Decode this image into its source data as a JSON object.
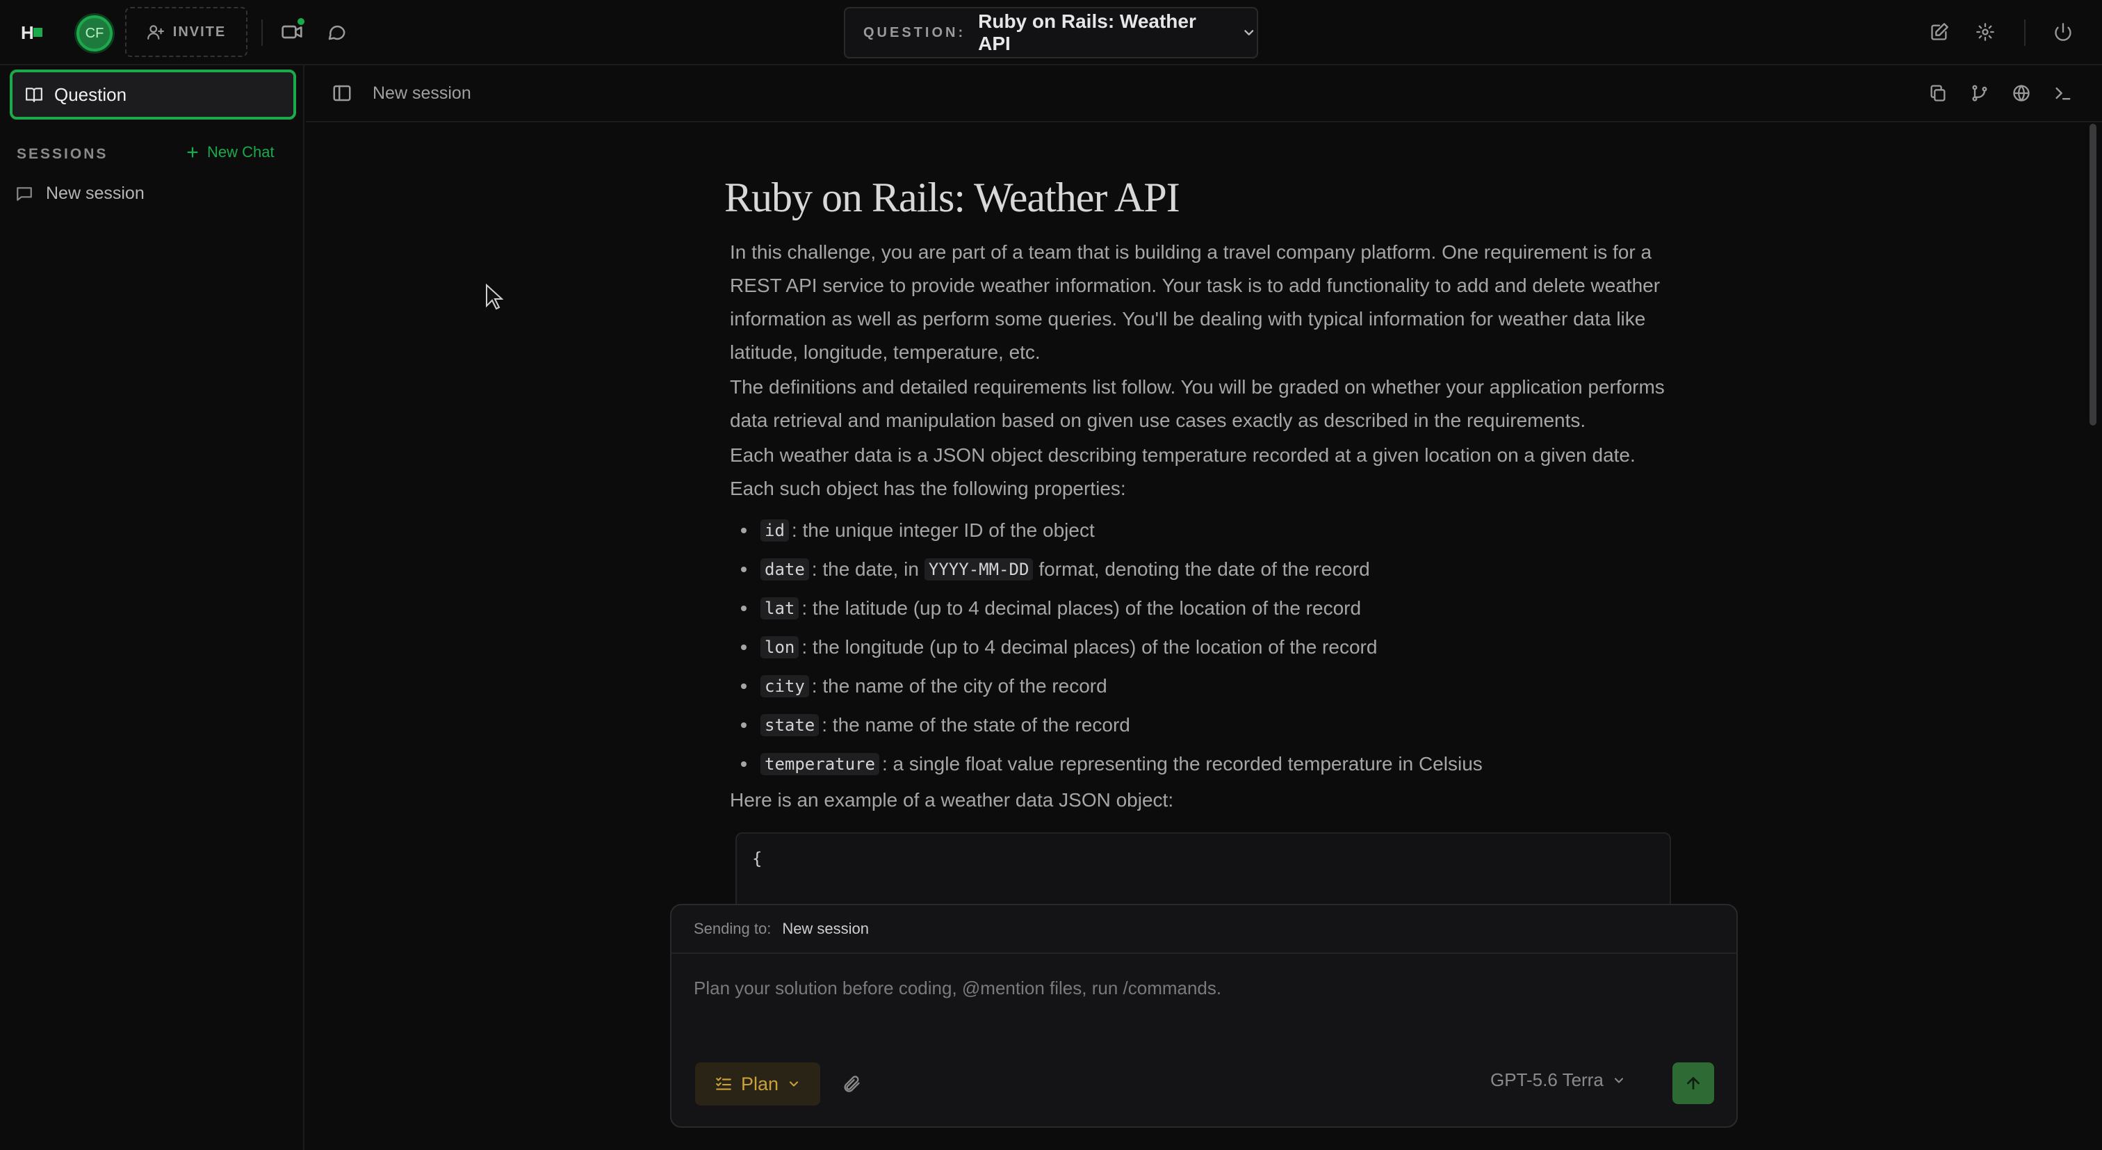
{
  "app": {
    "logo_text": "H",
    "accent": "#1ba94c"
  },
  "header": {
    "avatar_initials": "CF",
    "invite_label": "INVITE",
    "question_prefix": "QUESTION:",
    "question_title": "Ruby on Rails: Weather API"
  },
  "sidebar": {
    "question_tab_label": "Question",
    "sessions_header": "SESSIONS",
    "new_chat_label": "New Chat",
    "sessions": [
      {
        "label": "New session"
      }
    ]
  },
  "session_bar": {
    "title": "New session"
  },
  "document": {
    "title": "Ruby on Rails: Weather API",
    "paragraphs": [
      "In this challenge, you are part of a team that is building a travel company platform. One requirement is for a REST API service to provide weather information. Your task is to add functionality to add and delete weather information as well as perform some queries. You'll be dealing with typical information for weather data like latitude, longitude, temperature, etc.",
      "The definitions and detailed requirements list follow. You will be graded on whether your application performs data retrieval and manipulation based on given use cases exactly as described in the requirements.",
      "Each weather data is a JSON object describing temperature recorded at a given location on a given date. Each such object has the following properties:"
    ],
    "properties": [
      {
        "name": "id",
        "desc": ": the unique integer ID of the object"
      },
      {
        "name": "date",
        "desc_before": ": the date, in",
        "inline_code": "YYYY-MM-DD",
        "desc_after": "format, denoting the date of the record"
      },
      {
        "name": "lat",
        "desc": ": the latitude (up to 4 decimal places) of the location of the record"
      },
      {
        "name": "lon",
        "desc": ": the longitude (up to 4 decimal places) of the location of the record"
      },
      {
        "name": "city",
        "desc": ": the name of the city of the record"
      },
      {
        "name": "state",
        "desc": ": the name of the state of the record"
      },
      {
        "name": "temperature",
        "desc": ": a single float value representing the recorded temperature in Celsius"
      }
    ],
    "example_label": "Here is an example of a weather data JSON object:",
    "code_start": "{"
  },
  "composer": {
    "sending_to_label": "Sending to:",
    "sending_to_target": "New session",
    "placeholder": "Plan your solution before coding, @mention files, run /commands.",
    "mode_label": "Plan",
    "model_label": "GPT-5.6 Terra"
  }
}
